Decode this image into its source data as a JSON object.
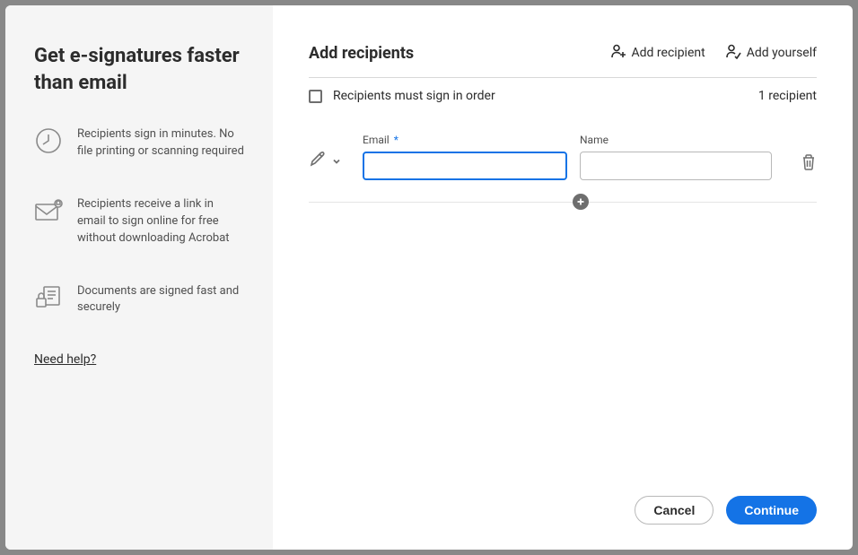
{
  "sidebar": {
    "title": "Get e-signatures faster than email",
    "features": [
      "Recipients sign in minutes. No file printing or scanning required",
      "Recipients receive a link in email to sign online for free without downloading Acrobat",
      "Documents are signed fast and securely"
    ],
    "help": "Need help?"
  },
  "main": {
    "title": "Add recipients",
    "addRecipient": "Add recipient",
    "addYourself": "Add yourself",
    "signInOrder": "Recipients must sign in order",
    "count": "1 recipient",
    "emailLabel": "Email",
    "requiredMark": "*",
    "nameLabel": "Name",
    "emailValue": "",
    "nameValue": ""
  },
  "footer": {
    "cancel": "Cancel",
    "continue": "Continue"
  }
}
